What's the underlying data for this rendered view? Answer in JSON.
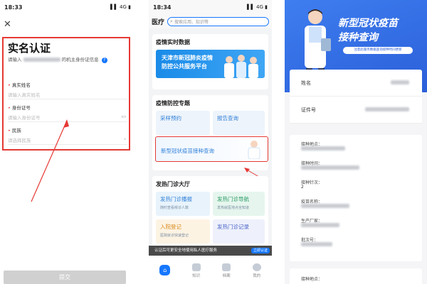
{
  "panel1": {
    "status": {
      "time": "18:33",
      "signal": "▌▌ 4G ▮"
    },
    "close_icon": "close-icon",
    "title": "实名认证",
    "hint_prefix": "请输入",
    "hint_suffix": "的机主身份证信息",
    "info_icon": "info-icon",
    "fields": [
      {
        "label": "真实姓名",
        "placeholder": "请输入真实姓名"
      },
      {
        "label": "身份证号",
        "placeholder": "请输入身份证号"
      },
      {
        "label": "民族",
        "placeholder": "请选择民族"
      }
    ],
    "submit_label": "提交",
    "accent": "#e53935"
  },
  "panel2": {
    "status": {
      "time": "18:34",
      "signal": "▌▌ 4G ▮"
    },
    "header_title": "医疗",
    "search_placeholder": "搜索应用、知识等",
    "sections": {
      "realtime": {
        "title": "疫情实时数据",
        "banner_line1": "天津市新冠肺炎疫情",
        "banner_line2": "防控公共服务平台"
      },
      "special": {
        "title": "疫情防控专题",
        "tiles": [
          "采样预约",
          "报告查询"
        ],
        "vaccine_entry": "新型冠状疫苗接种查询"
      },
      "clinic": {
        "title": "发热门诊大厅",
        "tiles": [
          {
            "title": "发热门诊播报",
            "sub": "随时查看候诊人数"
          },
          {
            "title": "发热门诊导航",
            "sub": "发热就医地点全知道"
          },
          {
            "title": "入院登记",
            "sub": "医院就诊快速登记"
          },
          {
            "title": "发热门诊记录",
            "sub": ""
          }
        ]
      }
    },
    "bottom_banner": {
      "text": "认证后可更安全地使用私人医疗服务",
      "button": "立即认证"
    },
    "tabs": [
      "首页",
      "知识",
      "档案",
      "我的"
    ],
    "brand": "#1677ff"
  },
  "panel3": {
    "hero_line1": "新型冠状疫苗",
    "hero_line2": "接种查询",
    "hero_pill": "注意此服务数据查询接种时间更新",
    "rows": [
      "姓名",
      "证件号"
    ],
    "details": [
      {
        "label": "接种地点：",
        "value": ""
      },
      {
        "label": "接种时间：",
        "value": ""
      },
      {
        "label": "接种针次：",
        "value": "2"
      },
      {
        "label": "疫苗名称：",
        "value": ""
      },
      {
        "label": "生产厂家：",
        "value": ""
      },
      {
        "label": "批次号：",
        "value": ""
      }
    ],
    "footer_label": "接种地点："
  }
}
